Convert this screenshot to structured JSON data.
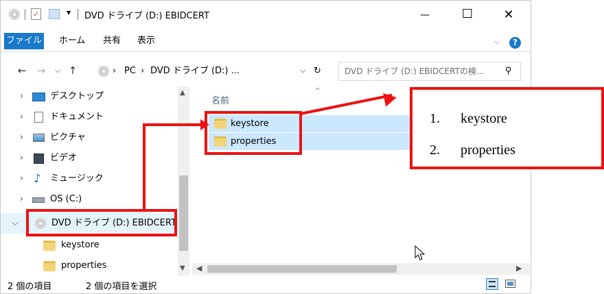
{
  "window": {
    "title": "DVD ドライブ (D:) EBIDCERT",
    "minimize": "—",
    "maximize": "☐",
    "close": "✕"
  },
  "ribbon": {
    "tabs": [
      "ファイル",
      "ホーム",
      "共有",
      "表示"
    ],
    "expand": "⌵",
    "help": "?"
  },
  "nav": {
    "back": "←",
    "forward": "→",
    "recent": "⌵",
    "up": "↑",
    "breadcrumb": [
      "PC",
      "DVD ドライブ (D:) ..."
    ],
    "sep": "›",
    "dropdown": "⌵",
    "refresh": "↻",
    "search_placeholder": "DVD ドライブ (D:) EBIDCERTの検...",
    "search_icon": "⚲"
  },
  "tree": {
    "items": [
      {
        "label": "デスクトップ",
        "icon": "desktop-icon"
      },
      {
        "label": "ドキュメント",
        "icon": "documents-icon"
      },
      {
        "label": "ピクチャ",
        "icon": "pictures-icon"
      },
      {
        "label": "ビデオ",
        "icon": "video-icon"
      },
      {
        "label": "ミュージック",
        "icon": "music-icon"
      },
      {
        "label": "OS (C:)",
        "icon": "drive-icon"
      },
      {
        "label": "DVD ドライブ (D:) EBIDCERT",
        "icon": "dvd-icon"
      },
      {
        "label": "keystore",
        "icon": "folder-icon"
      },
      {
        "label": "properties",
        "icon": "folder-icon"
      }
    ]
  },
  "content": {
    "column_header": "名前",
    "sort_arrow": "^",
    "files": [
      "keystore",
      "properties"
    ]
  },
  "status": {
    "count": "2 個の項目",
    "selected": "2 個の項目を選択"
  },
  "callout": {
    "items": [
      "1.",
      "keystore",
      "2.",
      "properties"
    ]
  },
  "colors": {
    "accent": "#1979ca",
    "selection": "#cce8ff",
    "annotation": "#ee1111"
  }
}
